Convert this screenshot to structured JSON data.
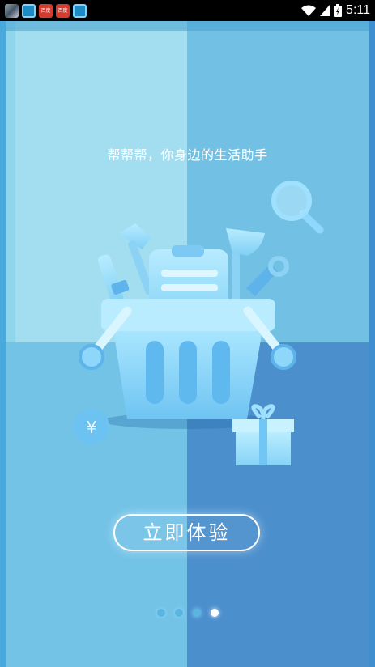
{
  "status_bar": {
    "time": "5:11",
    "notification_icons": [
      "gallery-icon",
      "browser-icon",
      "app-red-icon",
      "app-red-icon",
      "browser-icon"
    ],
    "red_app_label": "百度"
  },
  "onboarding": {
    "slogan": "帮帮帮，你身边的生活助手",
    "cta_label": "立即体验",
    "coin_symbol": "¥",
    "page_count": 4,
    "active_page": 4
  },
  "colors": {
    "quadrant_top_left": "#a3def0",
    "quadrant_top_right": "#72c1e4",
    "quadrant_bottom_left": "#73c3e7",
    "quadrant_bottom_right": "#4b8fcd",
    "illustration_accent": "#9fe0ff"
  }
}
